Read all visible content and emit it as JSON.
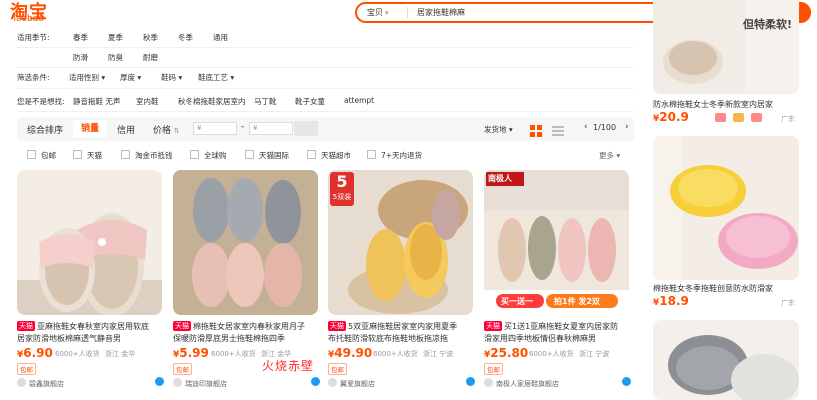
{
  "header": {
    "logo_cn": "淘宝",
    "logo_en": "Taobao",
    "search_scope": "宝贝",
    "search_query": "居家拖鞋棉麻",
    "search_button": "搜索"
  },
  "filters": {
    "season": {
      "label": "适用季节:",
      "values": [
        "春季",
        "夏季",
        "秋季",
        "冬季",
        "通用"
      ]
    },
    "function": {
      "values": [
        "防滑",
        "防臭",
        "耐磨"
      ]
    },
    "conditions": {
      "label": "筛选条件:",
      "values": [
        "适用性别",
        "厚度",
        "鞋码",
        "鞋底工艺"
      ]
    },
    "want": {
      "label": "您是不是想找:",
      "values": [
        "静音拖鞋 无声",
        "室内鞋",
        "秋冬棉拖鞋家居室内",
        "马丁靴",
        "靴子女童",
        "attempt"
      ]
    }
  },
  "sort": {
    "items": [
      "综合排序",
      "销量",
      "信用",
      "价格"
    ],
    "price_from": "¥",
    "price_to": "¥",
    "dash": "-",
    "delivery": "发货地",
    "page": "1/100"
  },
  "checks": [
    "包邮",
    "天猫",
    "淘金币抵钱",
    "全球购",
    "天猫国际",
    "天猫超市",
    "7+天内退货"
  ],
  "more": "更多",
  "products": [
    {
      "title1": "亚麻拖鞋女春秋室内家居用软底",
      "title2": "居家防滑地板棉麻透气静音男",
      "badge": "天猫",
      "price": "6.90",
      "sales": "6000+人收货",
      "location": "浙江 金华",
      "tag": "包邮",
      "shop": "碧鑫旗舰店"
    },
    {
      "title1": "棉拖鞋女居家室内春秋家用月子",
      "title2": "保暖防滑厚底男士拖鞋棉拖四季",
      "badge": "天猫",
      "price": "5.99",
      "sales": "6000+人收货",
      "location": "浙江 金华",
      "tag": "包邮",
      "shop": "瑞迪印旗舰店"
    },
    {
      "title1": "5双亚麻拖鞋居家室内家用夏季",
      "title2": "布托鞋防滑软底布拖鞋地板拖凉拖",
      "badge": "天猫",
      "price": "49.90",
      "sales": "6000+人收货",
      "location": "浙江 宁波",
      "tag": "包邮",
      "shop": "翼爱旗舰店",
      "img_tag": "5双装"
    },
    {
      "title1": "买1送1亚麻拖鞋女夏室内居家防",
      "title2": "滑家用四季地板情侣春秋棉麻男",
      "badge": "天猫",
      "price": "25.80",
      "sales": "6000+人收货",
      "location": "浙江 宁波",
      "tag": "包邮",
      "shop": "南极人家居鞋旗舰店",
      "img_brand": "南极人",
      "img_promo": "买一送一",
      "img_promo2": "拍1件 发2双"
    }
  ],
  "side": [
    {
      "title": "防水棉拖鞋女士冬季新款室内居家",
      "price": "20.9",
      "loc": "广东",
      "img_text": "但特柔软!"
    },
    {
      "title": "棉拖鞋女冬季拖鞋创意防水防滑家",
      "price": "18.9",
      "loc": "广东"
    }
  ],
  "watermark": "火烧赤壁",
  "colors": {
    "accent": "#ff5000",
    "tmall": "#ff0036"
  }
}
